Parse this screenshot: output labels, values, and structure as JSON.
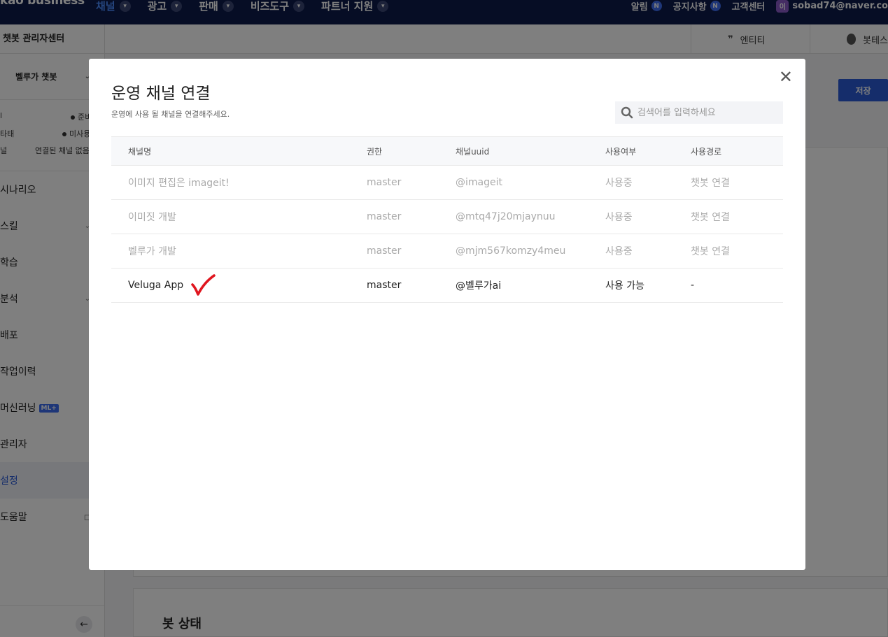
{
  "topnav": {
    "brand": "kao business",
    "menu": [
      {
        "label": "채널",
        "active": true
      },
      {
        "label": "광고",
        "active": false
      },
      {
        "label": "판매",
        "active": false
      },
      {
        "label": "비즈도구",
        "active": false
      },
      {
        "label": "파트너 지원",
        "active": false
      }
    ],
    "right": {
      "alerts": "알림",
      "alerts_badge": "N",
      "notices": "공지사항",
      "notices_badge": "N",
      "support": "고객센터",
      "avatar": "이",
      "user": "sobad74@naver.co"
    }
  },
  "sidebar": {
    "title": "챗봇 관리자센터",
    "bot_name": "벨루가 챗봇",
    "status": [
      {
        "label": "l",
        "value": "준비"
      },
      {
        "label": "타태",
        "value": "미사용"
      },
      {
        "label": "널",
        "value": "연결된 채널 없음"
      }
    ],
    "nav": [
      {
        "label": "시나리오",
        "chevron": false
      },
      {
        "label": "스킬",
        "chevron": true
      },
      {
        "label": "학습",
        "chevron": false
      },
      {
        "label": "분석",
        "chevron": true
      },
      {
        "label": "배포",
        "chevron": false
      },
      {
        "label": "작업이력",
        "chevron": false
      },
      {
        "label": "머신러닝",
        "badge": "ML+"
      },
      {
        "label": "관리자",
        "chevron": false
      },
      {
        "label": "설정",
        "active": true
      },
      {
        "label": "도움말",
        "chevron": false
      }
    ]
  },
  "content": {
    "tab_entity": "엔티티",
    "tab_bottest": "봇테스",
    "save": "저장",
    "bot_status_title": "봇 상태"
  },
  "modal": {
    "title": "운영 채널 연결",
    "subtitle": "운영에 사용 될 채널을 연결해주세요.",
    "search_placeholder": "검색어를 입력하세요",
    "columns": [
      "채널명",
      "권한",
      "채널uuid",
      "사용여부",
      "사용경로"
    ],
    "rows": [
      {
        "name": "이미지 편집은 imageit!",
        "role": "master",
        "uuid": "@imageit",
        "status": "사용중",
        "path": "챗봇 연결",
        "enabled": false
      },
      {
        "name": "이미짓 개발",
        "role": "master",
        "uuid": "@mtq47j20mjaynuu",
        "status": "사용중",
        "path": "챗봇 연결",
        "enabled": false
      },
      {
        "name": "벨루가 개발",
        "role": "master",
        "uuid": "@mjm567komzy4meu",
        "status": "사용중",
        "path": "챗봇 연결",
        "enabled": false
      },
      {
        "name": "Veluga App",
        "role": "master",
        "uuid": "@벨루가ai",
        "status": "사용 가능",
        "path": "-",
        "enabled": true,
        "checked": true
      }
    ],
    "check_color": "#e0161f"
  }
}
